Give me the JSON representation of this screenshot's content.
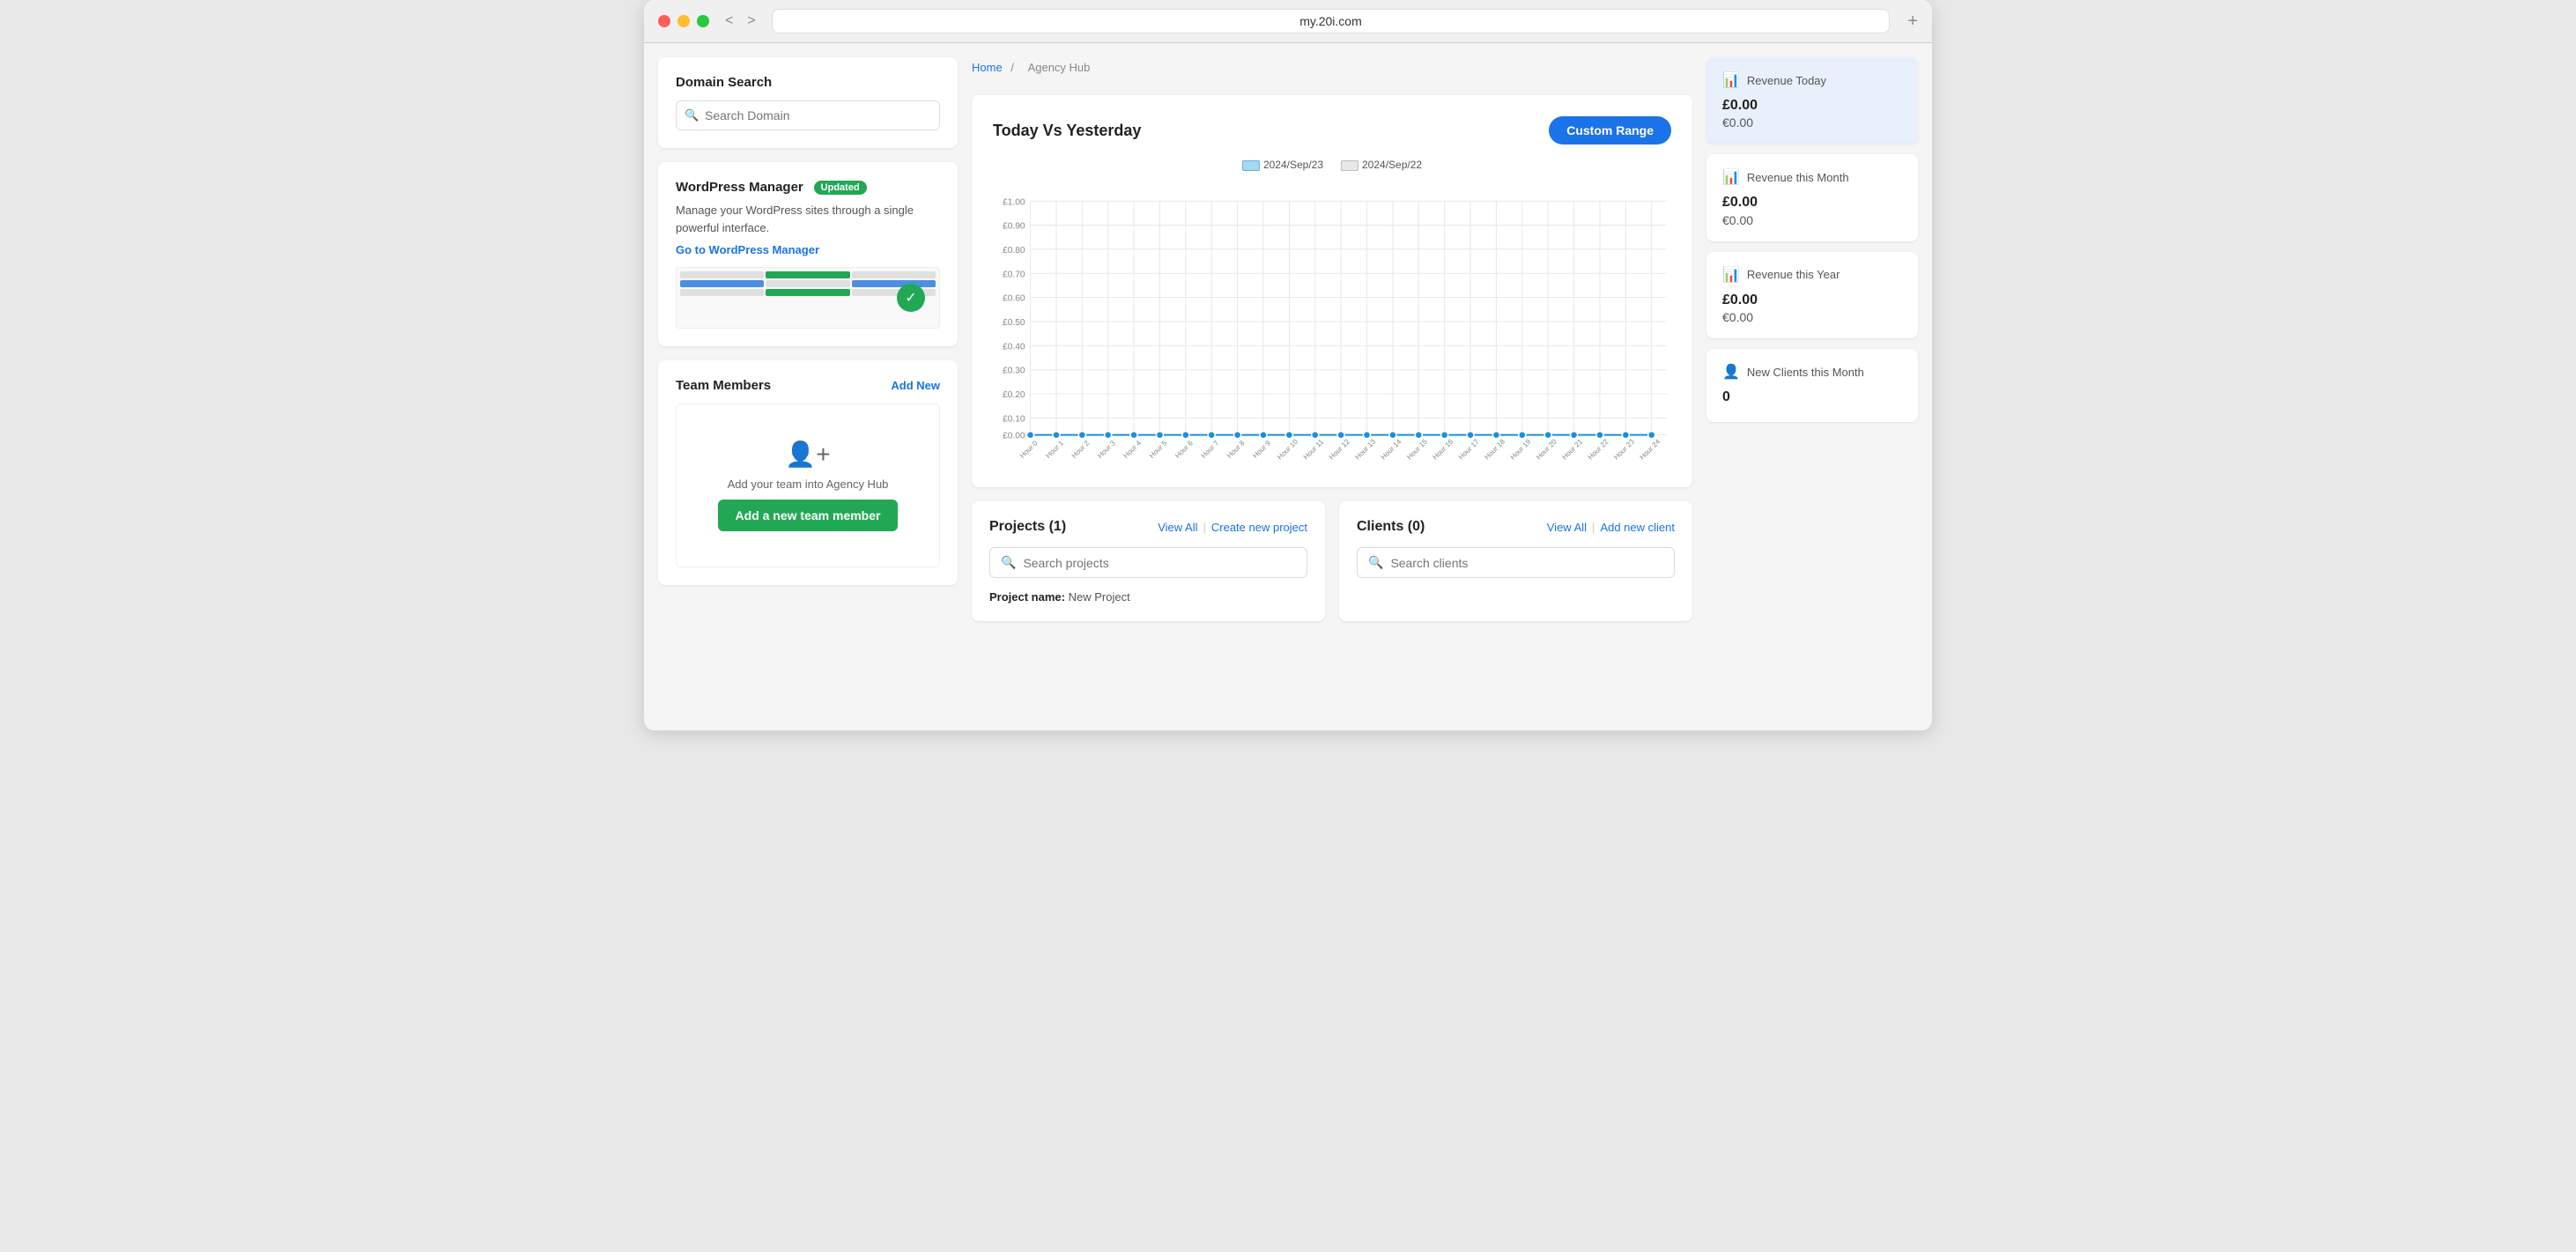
{
  "browser": {
    "url": "my.20i.com",
    "back_label": "<",
    "forward_label": ">",
    "new_tab_label": "+"
  },
  "breadcrumb": {
    "home": "Home",
    "separator": "/",
    "current": "Agency Hub"
  },
  "domain_search": {
    "title": "Domain Search",
    "placeholder": "Search Domain"
  },
  "wordpress_manager": {
    "title": "WordPress Manager",
    "badge": "Updated",
    "description": "Manage your WordPress sites through a single powerful interface.",
    "link_label": "Go to WordPress Manager"
  },
  "team_members": {
    "title": "Team Members",
    "add_new_label": "Add New",
    "empty_text": "Add your team into Agency Hub",
    "add_button_label": "Add a new team member"
  },
  "chart": {
    "title": "Today Vs Yesterday",
    "custom_range_label": "Custom Range",
    "legend_today": "2024/Sep/23",
    "legend_yesterday": "2024/Sep/22",
    "y_labels": [
      "£1.00",
      "£0.90",
      "£0.80",
      "£0.70",
      "£0.60",
      "£0.50",
      "£0.40",
      "£0.30",
      "£0.20",
      "£0.10",
      "£0.00"
    ],
    "x_labels": [
      "Hour 0",
      "Hour 1",
      "Hour 2",
      "Hour 3",
      "Hour 4",
      "Hour 5",
      "Hour 6",
      "Hour 7",
      "Hour 8",
      "Hour 9",
      "Hour 10",
      "Hour 11",
      "Hour 12",
      "Hour 13",
      "Hour 14",
      "Hour 15",
      "Hour 16",
      "Hour 17",
      "Hour 18",
      "Hour 19",
      "Hour 20",
      "Hour 21",
      "Hour 22",
      "Hour 23",
      "Hour 24"
    ]
  },
  "projects": {
    "title": "Projects",
    "count": "(1)",
    "view_all_label": "View All",
    "create_label": "Create new project",
    "search_placeholder": "Search projects",
    "project_name_label": "Project name:",
    "project_name_value": "New Project"
  },
  "clients": {
    "title": "Clients",
    "count": "(0)",
    "view_all_label": "View All",
    "add_label": "Add new client",
    "search_placeholder": "Search clients"
  },
  "revenue_today": {
    "label": "Revenue Today",
    "gbp": "£0.00",
    "eur": "€0.00"
  },
  "revenue_month": {
    "label": "Revenue this Month",
    "gbp": "£0.00",
    "eur": "€0.00"
  },
  "revenue_year": {
    "label": "Revenue this Year",
    "gbp": "£0.00",
    "eur": "€0.00"
  },
  "new_clients": {
    "label": "New Clients this Month",
    "value": "0"
  }
}
